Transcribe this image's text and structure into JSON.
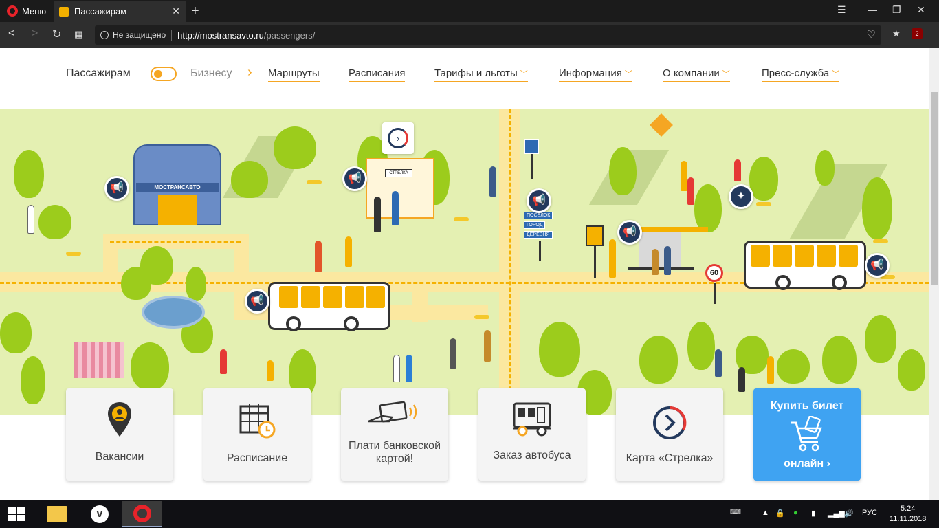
{
  "browser": {
    "menu_label": "Меню",
    "tab_title": "Пассажирам",
    "security_label": "Не защищено",
    "url_host": "http://mostransavto.ru",
    "url_path": "/passengers/",
    "ext_badge": "2"
  },
  "nav": {
    "passengers": "Пассажирам",
    "business": "Бизнесу",
    "links": [
      {
        "label": "Маршруты",
        "dropdown": false
      },
      {
        "label": "Расписания",
        "dropdown": false
      },
      {
        "label": "Тарифы и льготы",
        "dropdown": true
      },
      {
        "label": "Информация",
        "dropdown": true
      },
      {
        "label": "О компании",
        "dropdown": true
      },
      {
        "label": "Пресс-служба",
        "dropdown": true
      }
    ]
  },
  "hero": {
    "building_sign": "МОСТРАНСАВТО",
    "kiosk_sign": "СТРЕЛКА",
    "road_signs": [
      "ПОСЕЛОК",
      "ГОРОД",
      "ДЕРЕВНЯ"
    ],
    "speed_limit": "60"
  },
  "cards": [
    {
      "label": "Вакансии",
      "icon": "location-pin-icon"
    },
    {
      "label": "Расписание",
      "icon": "calendar-clock-icon"
    },
    {
      "label": "Плати банковской картой!",
      "icon": "card-payment-icon"
    },
    {
      "label": "Заказ автобуса",
      "icon": "bus-icon"
    },
    {
      "label": "Карта «Стрелка»",
      "icon": "strelka-icon"
    },
    {
      "label_top": "Купить билет",
      "label_bottom": "онлайн",
      "icon": "shopping-cart-icon"
    }
  ],
  "taskbar": {
    "language": "РУС",
    "time": "5:24",
    "date": "11.11.2018"
  },
  "colors": {
    "accent": "#f5a623",
    "buy_button": "#3fa3f2",
    "hero_bg": "#e4f0b2"
  }
}
